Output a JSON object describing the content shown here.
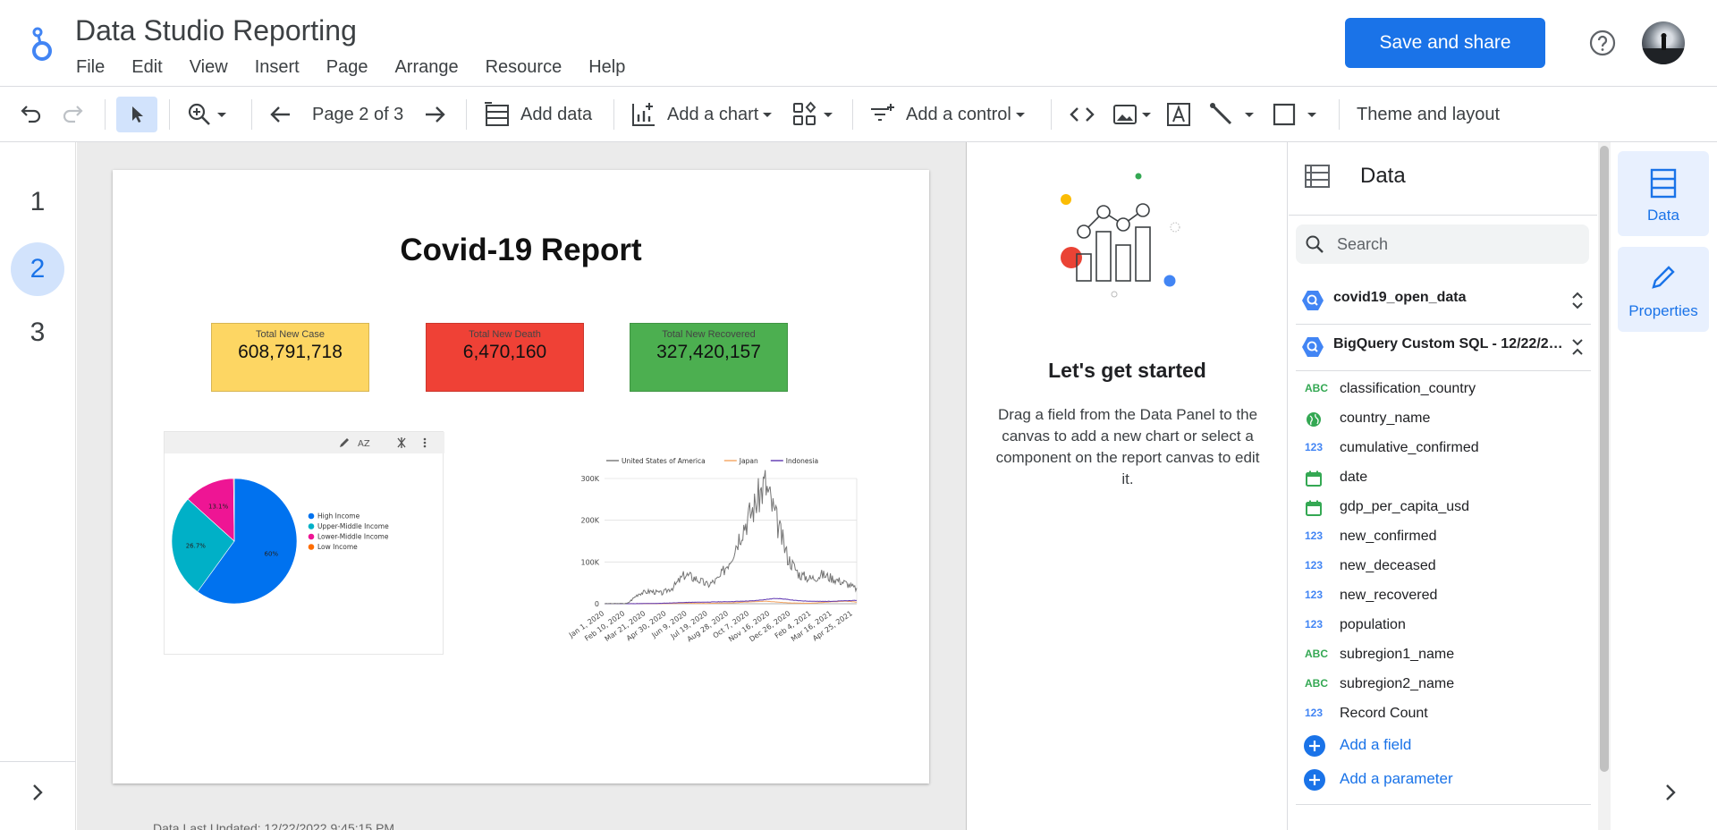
{
  "header": {
    "app_title": "Data Studio Reporting",
    "menu": [
      "File",
      "Edit",
      "View",
      "Insert",
      "Page",
      "Arrange",
      "Resource",
      "Help"
    ],
    "save_share_label": "Save and share"
  },
  "toolbar": {
    "page_indicator": "Page 2 of 3",
    "add_data": "Add data",
    "add_chart": "Add a chart",
    "add_control": "Add a control",
    "theme_layout": "Theme and layout"
  },
  "pages": [
    "1",
    "2",
    "3"
  ],
  "active_page": "2",
  "report": {
    "title": "Covid-19 Report",
    "kpis": [
      {
        "label": "Total New Case",
        "value": "608,791,718",
        "color": "#fdd663"
      },
      {
        "label": "Total New Death",
        "value": "6,470,160",
        "color": "#ef4136"
      },
      {
        "label": "Total New Recovered",
        "value": "327,420,157",
        "color": "#4caf50"
      }
    ],
    "data_updated": "Data Last Updated: 12/22/2022 9:45:15 PM"
  },
  "chart_data": [
    {
      "type": "pie",
      "categories": [
        "High Income",
        "Upper-Middle Income",
        "Lower-Middle Income",
        "Low Income"
      ],
      "values": [
        60,
        26.7,
        13.1,
        0.2
      ],
      "slice_labels": [
        "60%",
        "26.7%",
        "13.1%",
        ""
      ],
      "colors": [
        "#0072ef",
        "#00b0c7",
        "#ee1594",
        "#ff6d00"
      ],
      "legend": "right"
    },
    {
      "type": "line",
      "series": [
        {
          "name": "United States of America",
          "color": "#757575"
        },
        {
          "name": "Japan",
          "color": "#f4a460"
        },
        {
          "name": "Indonesia",
          "color": "#5e35b1"
        }
      ],
      "x_ticks": [
        "Jan 1, 2020",
        "Feb 10, 2020",
        "Mar 21, 2020",
        "Apr 30, 2020",
        "Jun 9, 2020",
        "Jul 19, 2020",
        "Aug 28, 2020",
        "Oct 7, 2020",
        "Nov 16, 2020",
        "Dec 26, 2020",
        "Feb 4, 2021",
        "Mar 16, 2021",
        "Apr 25, 2021"
      ],
      "y_ticks": [
        "0",
        "100K",
        "200K",
        "300K"
      ],
      "ylim": [
        0,
        300000
      ],
      "usa_profile": [
        0,
        0,
        500,
        25000,
        30000,
        25000,
        40000,
        70000,
        60000,
        45000,
        60000,
        110000,
        180000,
        230000,
        290000,
        200000,
        110000,
        70000,
        60000,
        70000,
        60000,
        50000,
        35000
      ],
      "japan_profile": [
        0,
        0,
        0,
        200,
        300,
        200,
        600,
        1200,
        900,
        800,
        1500,
        2000,
        3500,
        5000,
        6000,
        4000,
        2000,
        1500,
        1200,
        3000,
        5000,
        6000,
        4000
      ],
      "indonesia_profile": [
        0,
        0,
        0,
        200,
        500,
        1000,
        2000,
        3000,
        3500,
        4000,
        4500,
        5000,
        6000,
        7000,
        10000,
        13000,
        10000,
        7000,
        6000,
        5500,
        6000,
        7000,
        8000
      ],
      "legend": "top"
    }
  ],
  "get_started": {
    "title": "Let's get started",
    "description": "Drag a field from the Data Panel to the canvas to add a new chart or select a component on the report canvas to edit it."
  },
  "data_panel": {
    "title": "Data",
    "search_placeholder": "Search",
    "sources": [
      "covid19_open_data",
      "BigQuery Custom SQL - 12/22/22,..."
    ],
    "fields": [
      {
        "type": "ABC",
        "name": "classification_country"
      },
      {
        "type": "geo",
        "name": "country_name"
      },
      {
        "type": "123",
        "name": "cumulative_confirmed"
      },
      {
        "type": "date",
        "name": "date"
      },
      {
        "type": "date",
        "name": "gdp_per_capita_usd"
      },
      {
        "type": "123",
        "name": "new_confirmed"
      },
      {
        "type": "123",
        "name": "new_deceased"
      },
      {
        "type": "123",
        "name": "new_recovered"
      },
      {
        "type": "123",
        "name": "population"
      },
      {
        "type": "ABC",
        "name": "subregion1_name"
      },
      {
        "type": "ABC",
        "name": "subregion2_name"
      },
      {
        "type": "123",
        "name": "Record Count"
      }
    ],
    "add_field": "Add a field",
    "add_parameter": "Add a parameter"
  },
  "right_rail": {
    "data_label": "Data",
    "properties_label": "Properties"
  }
}
